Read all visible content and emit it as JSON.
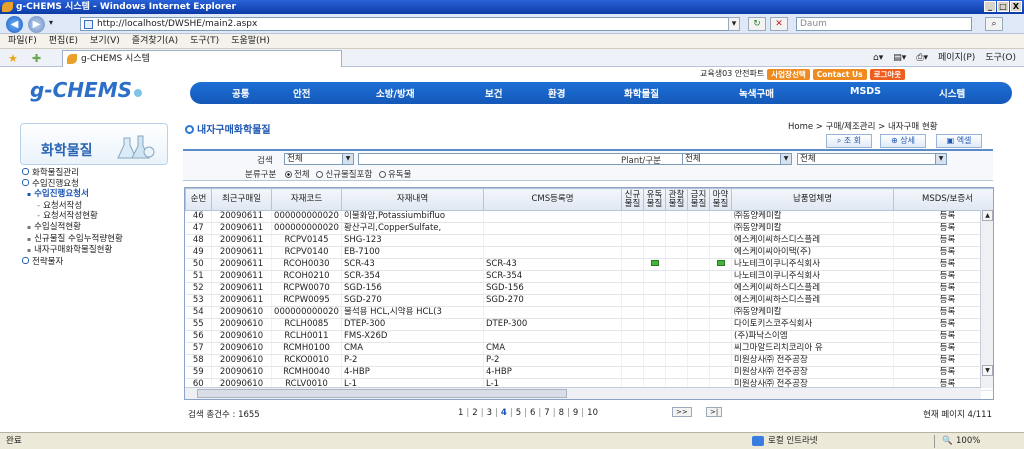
{
  "window": {
    "title": "g-CHEMS 시스템 - Windows Internet Explorer",
    "controls": [
      "_",
      "□",
      "X"
    ]
  },
  "browser": {
    "url": "http://localhost/DWSHE/main2.aspx",
    "search_placeholder": "Daum",
    "menu": [
      "파일(F)",
      "편집(E)",
      "보기(V)",
      "즐겨찾기(A)",
      "도구(T)",
      "도움말(H)"
    ],
    "tab_title": "g-CHEMS 시스템",
    "tools": [
      "페이지(P)",
      "도구(O)"
    ]
  },
  "header": {
    "user_text": "교육생03 안전파트",
    "buttons": [
      "사업장선택",
      "Contact Us",
      "로그아웃"
    ],
    "logo": "g-CHEMS",
    "nav": [
      "공통",
      "안전",
      "소방/방재",
      "보건",
      "환경",
      "화학물질",
      "녹색구매",
      "MSDS",
      "시스템"
    ]
  },
  "sidebar": {
    "title": "화학물질",
    "items": [
      {
        "label": "화학물질관리",
        "level": 0
      },
      {
        "label": "수입진행요청",
        "level": 0
      },
      {
        "label": "수입진행요청서",
        "level": 1,
        "active": true
      },
      {
        "label": "요청서작성",
        "level": 2
      },
      {
        "label": "요청서작성현황",
        "level": 2
      },
      {
        "label": "수입실적현황",
        "level": 1
      },
      {
        "label": "신규물질 수입누적량현황",
        "level": 1
      },
      {
        "label": "내자구매화학물질현황",
        "level": 1
      },
      {
        "label": "전략물자",
        "level": 0
      }
    ]
  },
  "page": {
    "title": "내자구매화학물질",
    "breadcrumb": "Home > 구매/제조관리 > 내자구매 현황",
    "actions": [
      "조 회",
      "상세",
      "엑셀"
    ]
  },
  "search": {
    "label_search": "검색",
    "search_select": "전체",
    "label_plant": "Plant/구분",
    "plant_select": "전체",
    "type_select": "전체",
    "label_classification": "분류구분",
    "radios": [
      {
        "label": "전체",
        "checked": true
      },
      {
        "label": "신규물질포함",
        "checked": false
      },
      {
        "label": "유독물",
        "checked": false
      }
    ]
  },
  "table": {
    "headers": [
      "순번",
      "최근구매일",
      "자재코드",
      "자재내역",
      "CMS등록명",
      "신규\n물질",
      "유독\n물질",
      "관찰\n물질",
      "금지\n물질",
      "마약\n물질",
      "납품업체명",
      "MSDS/보증서"
    ],
    "rows": [
      [
        "46",
        "20090611",
        "000000000020",
        "이불화암,Potassiumbifluo",
        "",
        "",
        "",
        "",
        "",
        "",
        "㈜동양케미칼",
        "등록"
      ],
      [
        "47",
        "20090611",
        "000000000020",
        "황산구리,CopperSulfate,",
        "",
        "",
        "",
        "",
        "",
        "",
        "㈜동양케미칼",
        "등록"
      ],
      [
        "48",
        "20090611",
        "RCPV0145",
        "SHG-123",
        "",
        "",
        "",
        "",
        "",
        "",
        "에스케이씨하스디스플레",
        "등록"
      ],
      [
        "49",
        "20090611",
        "RCPV0140",
        "EB-7100",
        "",
        "",
        "",
        "",
        "",
        "",
        "에스케이씨아이택(주)",
        "등록"
      ],
      [
        "50",
        "20090611",
        "RCOH0030",
        "SCR-43",
        "SCR-43",
        "",
        "●",
        "",
        "",
        "●",
        "나노테크이쿠니주식회사",
        "등록"
      ],
      [
        "51",
        "20090611",
        "RCOH0210",
        "SCR-354",
        "SCR-354",
        "",
        "",
        "",
        "",
        "",
        "나노테크이쿠니주식회사",
        "등록"
      ],
      [
        "52",
        "20090611",
        "RCPW0070",
        "SGD-156",
        "SGD-156",
        "",
        "",
        "",
        "",
        "",
        "에스케이씨하스디스플레",
        "등록"
      ],
      [
        "53",
        "20090611",
        "RCPW0095",
        "SGD-270",
        "SGD-270",
        "",
        "",
        "",
        "",
        "",
        "에스케이씨하스디스플레",
        "등록"
      ],
      [
        "54",
        "20090610",
        "000000000020",
        "불석용 HCL,시약용 HCL(3",
        "",
        "",
        "",
        "",
        "",
        "",
        "㈜동양케미칼",
        "등록"
      ],
      [
        "55",
        "20090610",
        "RCLH0085",
        "DTEP-300",
        "DTEP-300",
        "",
        "",
        "",
        "",
        "",
        "다이토키스코주식회사",
        "등록"
      ],
      [
        "56",
        "20090610",
        "RCLH0011",
        "FMS-X26D",
        "",
        "",
        "",
        "",
        "",
        "",
        "(주)파낙스이엠",
        "등록"
      ],
      [
        "57",
        "20090610",
        "RCMH0100",
        "CMA",
        "CMA",
        "",
        "",
        "",
        "",
        "",
        "씨그마알드리치코리아 유",
        "등록"
      ],
      [
        "58",
        "20090610",
        "RCKO0010",
        "P-2",
        "P-2",
        "",
        "",
        "",
        "",
        "",
        "미원상사㈜ 전주공장",
        "등록"
      ],
      [
        "59",
        "20090610",
        "RCMH0040",
        "4-HBP",
        "4-HBP",
        "",
        "",
        "",
        "",
        "",
        "미원상사㈜ 전주공장",
        "등록"
      ],
      [
        "60",
        "20090610",
        "RCLV0010",
        "L-1",
        "L-1",
        "",
        "",
        "",
        "",
        "",
        "미원상사㈜ 전주공장",
        "등록"
      ]
    ]
  },
  "footer": {
    "total_label": "검색 총건수 : 1655",
    "pages": [
      "1",
      "2",
      "3",
      "4",
      "5",
      "6",
      "7",
      "8",
      "9",
      "10"
    ],
    "current_page": "4",
    "page_info": "현재 페이지 4/111"
  },
  "statusbar": {
    "left": "완료",
    "zone": "로컬 인트라넷",
    "zoom": "100%"
  }
}
